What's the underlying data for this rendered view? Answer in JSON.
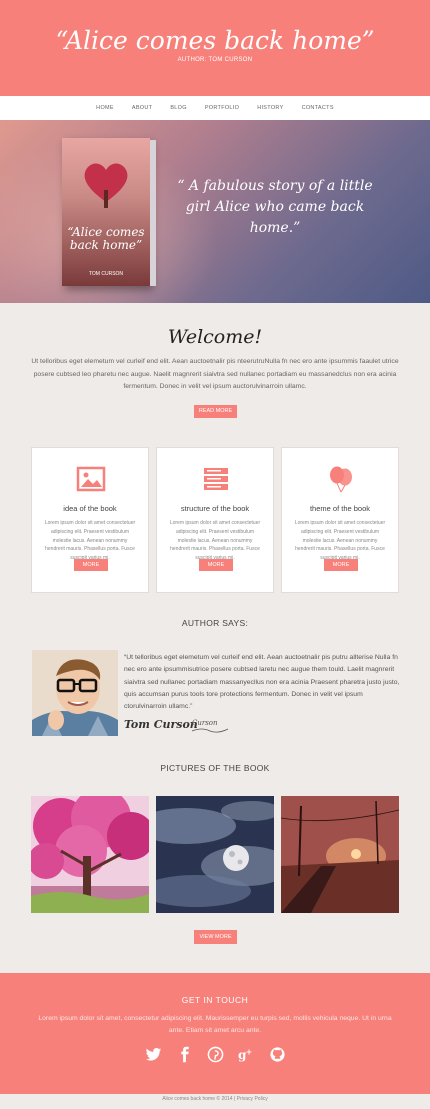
{
  "header": {
    "title": "“Alice comes back home”",
    "author": "AUTHOR: TOM CURSON"
  },
  "nav": [
    "HOME",
    "ABOUT",
    "BLOG",
    "PORTFOLIO",
    "HISTORY",
    "CONTACTS"
  ],
  "hero": {
    "book_title": "“Alice comes back home”",
    "book_author": "TOM CURSON",
    "quote": "“ A fabulous story of a little girl Alice who came back home.”"
  },
  "welcome": {
    "title": "Welcome!",
    "text": "Ut telloribus eget elemetum vel curleif end elit. Aean auctoetnalir pis nteerutruNulla fn nec ero ante ipsummis faaulet utrice posere cubtsed leo pharetu nec augue. Naelit magnrerit siaivtra sed nullanec portadiam eu massanedclus non era acinia fermentum. Donec in velit vel ipsum auctorulvinarroin ullamc.",
    "button": "READ MORE"
  },
  "cards": [
    {
      "icon": "image-icon",
      "title": "idea of the book",
      "text": "Lorem ipsum dolor sit amet consectetuer adipiscing elit. Praesent vestibulum molestie lacus. Aenean nonummy hendrerit mauris. Phasellus porta. Fusce suscipit varius mi.",
      "button": "MORE"
    },
    {
      "icon": "books-icon",
      "title": "structure of the book",
      "text": "Lorem ipsum dolor sit amet consectetuer adipiscing elit. Praesent vestibulum molestie lacus. Aenean nonummy hendrerit mauris. Phasellus porta. Fusce suscipit varius mi.",
      "button": "MORE"
    },
    {
      "icon": "balloons-icon",
      "title": "theme of the book",
      "text": "Lorem ipsum dolor sit amet consectetuer adipiscing elit. Praesent vestibulum molestie lacus. Aenean nonummy hendrerit mauris. Phasellus porta. Fusce suscipit varius mi.",
      "button": "MORE"
    }
  ],
  "author_says": {
    "heading": "AUTHOR SAYS:",
    "quote": "“Ut telloribus eget elemetum vel curleif end elit. Aean auctoetnalir pis putru allterise Nulla fn nec ero ante ipsummisutrice posere cubtsed laretu nec augue them tould. Laelit magnrerit siaivtra sed nullanec portadiam massanyecllus non era acinia Praesent pharetra justo justo, quis accumsan purus tools tore protections fermentum. Donec in velit vel ipsum ctorulvinarroin ullamc.”",
    "name": "Tom Curson",
    "signature": "Curson"
  },
  "pictures": {
    "heading": "PICTURES OF THE BOOK",
    "button": "VIEW MORE"
  },
  "footer": {
    "title": "GET IN TOUCH",
    "text": "Lorem ipsum dolor sit amet, consectetur adipiscing elit. Maurissemper eu turpis sed, mollis vehicula neque. Ut in urna ante. Etiam sit amet arcu ante.",
    "socials": [
      "twitter-icon",
      "facebook-icon",
      "pinterest-icon",
      "google-plus-icon",
      "github-icon"
    ],
    "copyright": "Alice comes back home © 2014  |  Privacy Policy"
  },
  "colors": {
    "accent": "#f7807a",
    "background": "#efebe8"
  }
}
